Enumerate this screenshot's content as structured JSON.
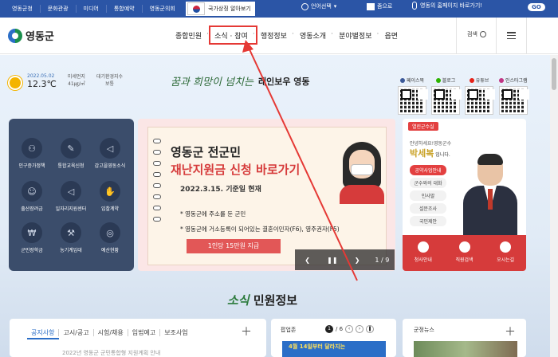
{
  "topbar": {
    "links": [
      "영동군청",
      "문화관광",
      "미디어",
      "통합예약",
      "영동군의회"
    ],
    "gov_label": "국가상징 알아보기",
    "lang_label": "언어선택",
    "zoom_label": "줌으로",
    "voice_label": "영동의 홈페이지 바로가기!",
    "go_label": "GO"
  },
  "nav": {
    "logo": "영동군",
    "menu": [
      "종합민원",
      "소식 · 참여",
      "행정정보",
      "영동소개",
      "분야별정보",
      "읍면"
    ],
    "search_label": "검색"
  },
  "weather": {
    "date": "2022.05.02",
    "temp": "12.3℃",
    "dust_label": "미세먼지",
    "dust_value": "41㎍/㎥",
    "air_label": "대기환경지수",
    "air_value": "보통"
  },
  "slogan": {
    "script": "꿈과 희망이 넘치는",
    "main": "레인보우 영동"
  },
  "sns": [
    {
      "label": "페이스북",
      "color": "#3b5998"
    },
    {
      "label": "블로그",
      "color": "#2db400"
    },
    {
      "label": "유튜브",
      "color": "#e62117"
    },
    {
      "label": "인스타그램",
      "color": "#c13584"
    }
  ],
  "quick": [
    {
      "label": "인구증가정책",
      "icon": "people-icon"
    },
    {
      "label": "통합교육신청",
      "icon": "pencil-icon"
    },
    {
      "label": "감고을영동소식",
      "icon": "megaphone-icon"
    },
    {
      "label": "출산장려금",
      "icon": "baby-icon"
    },
    {
      "label": "일자리지원센터",
      "icon": "megaphone-icon"
    },
    {
      "label": "입찰계약",
      "icon": "handshake-icon"
    },
    {
      "label": "군민장학금",
      "icon": "money-icon"
    },
    {
      "label": "농기계임대",
      "icon": "tools-icon"
    },
    {
      "label": "예산현황",
      "icon": "coins-icon"
    }
  ],
  "banner": {
    "title1": "영동군 전군민",
    "title2": "재난지원금 신청 바로가기",
    "subtitle": "2022.3.15. 기준일 현재",
    "line1": "* 영동군에 주소를 둔 군민",
    "line2": "* 영동군에 거소등록이 되어있는 결혼이민자(F6), 영주권자(F5)",
    "amount": "1인당 15만원 지급",
    "counter": "1 / 9"
  },
  "mayor": {
    "tag": "열린군수실",
    "greeting": "안녕하세요!영동군수",
    "name_prefix": "",
    "name": "박세복",
    "name_suffix": "입니다.",
    "buttons": [
      "공약사업안내",
      "군수와의 대화",
      "인사말",
      "설문조사",
      "국민제안"
    ],
    "footer": [
      "청사안내",
      "직원검색",
      "오시는길"
    ]
  },
  "section": {
    "accent": "소식",
    "title": "민원정보"
  },
  "notice": {
    "tabs": [
      "공지사항",
      "고시/공고",
      "시험/채용",
      "입법예고",
      "보조사업"
    ],
    "news": "2022년 영동군 군민통합형 지원계획 안내"
  },
  "popup": {
    "title": "팝업존",
    "page": "1",
    "total": "/ 6",
    "headline": "4월 14일부터 달라지는"
  },
  "county_news": {
    "title": "군정뉴스"
  },
  "colors": {
    "topbar": "#2b55a6",
    "accent_red": "#e53935",
    "quick_panel": "#3b4d6b"
  }
}
